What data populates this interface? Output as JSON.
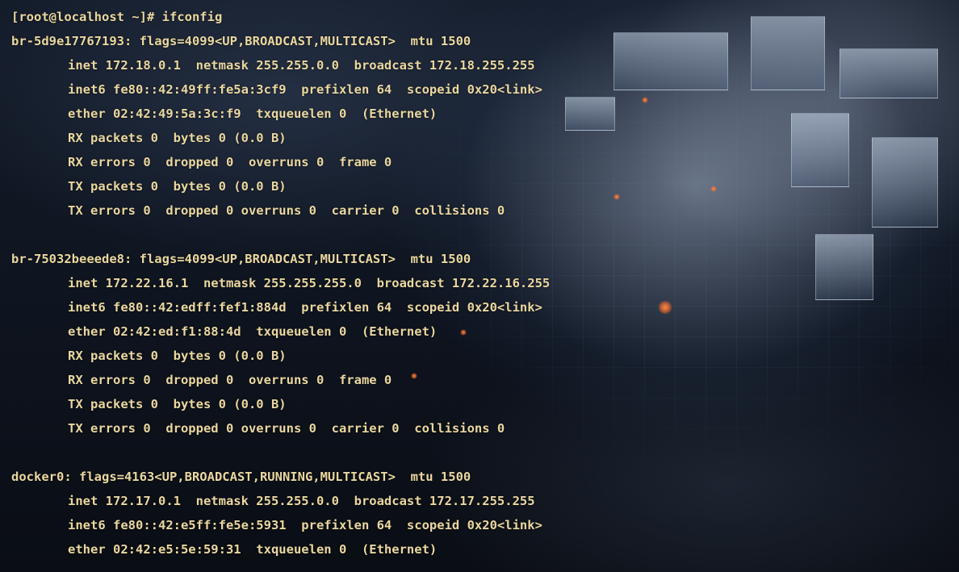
{
  "terminal": {
    "lines": [
      "[root@localhost ~]# ifconfig",
      "br-5d9e17767193: flags=4099<UP,BROADCAST,MULTICAST>  mtu 1500",
      "inet 172.18.0.1  netmask 255.255.0.0  broadcast 172.18.255.255",
      "inet6 fe80::42:49ff:fe5a:3cf9  prefixlen 64  scopeid 0x20<link>",
      "ether 02:42:49:5a:3c:f9  txqueuelen 0  (Ethernet)",
      "RX packets 0  bytes 0 (0.0 B)",
      "RX errors 0  dropped 0  overruns 0  frame 0",
      "TX packets 0  bytes 0 (0.0 B)",
      "TX errors 0  dropped 0 overruns 0  carrier 0  collisions 0",
      "",
      "br-75032beeede8: flags=4099<UP,BROADCAST,MULTICAST>  mtu 1500",
      "inet 172.22.16.1  netmask 255.255.255.0  broadcast 172.22.16.255",
      "inet6 fe80::42:edff:fef1:884d  prefixlen 64  scopeid 0x20<link>",
      "ether 02:42:ed:f1:88:4d  txqueuelen 0  (Ethernet)",
      "RX packets 0  bytes 0 (0.0 B)",
      "RX errors 0  dropped 0  overruns 0  frame 0",
      "TX packets 0  bytes 0 (0.0 B)",
      "TX errors 0  dropped 0 overruns 0  carrier 0  collisions 0",
      "",
      "docker0: flags=4163<UP,BROADCAST,RUNNING,MULTICAST>  mtu 1500",
      "inet 172.17.0.1  netmask 255.255.0.0  broadcast 172.17.255.255",
      "inet6 fe80::42:e5ff:fe5e:5931  prefixlen 64  scopeid 0x20<link>",
      "ether 02:42:e5:5e:59:31  txqueuelen 0  (Ethernet)"
    ]
  },
  "colors": {
    "text": "#ead7a0",
    "background": "#0b1019",
    "accent_spark": "#ff8a40"
  }
}
